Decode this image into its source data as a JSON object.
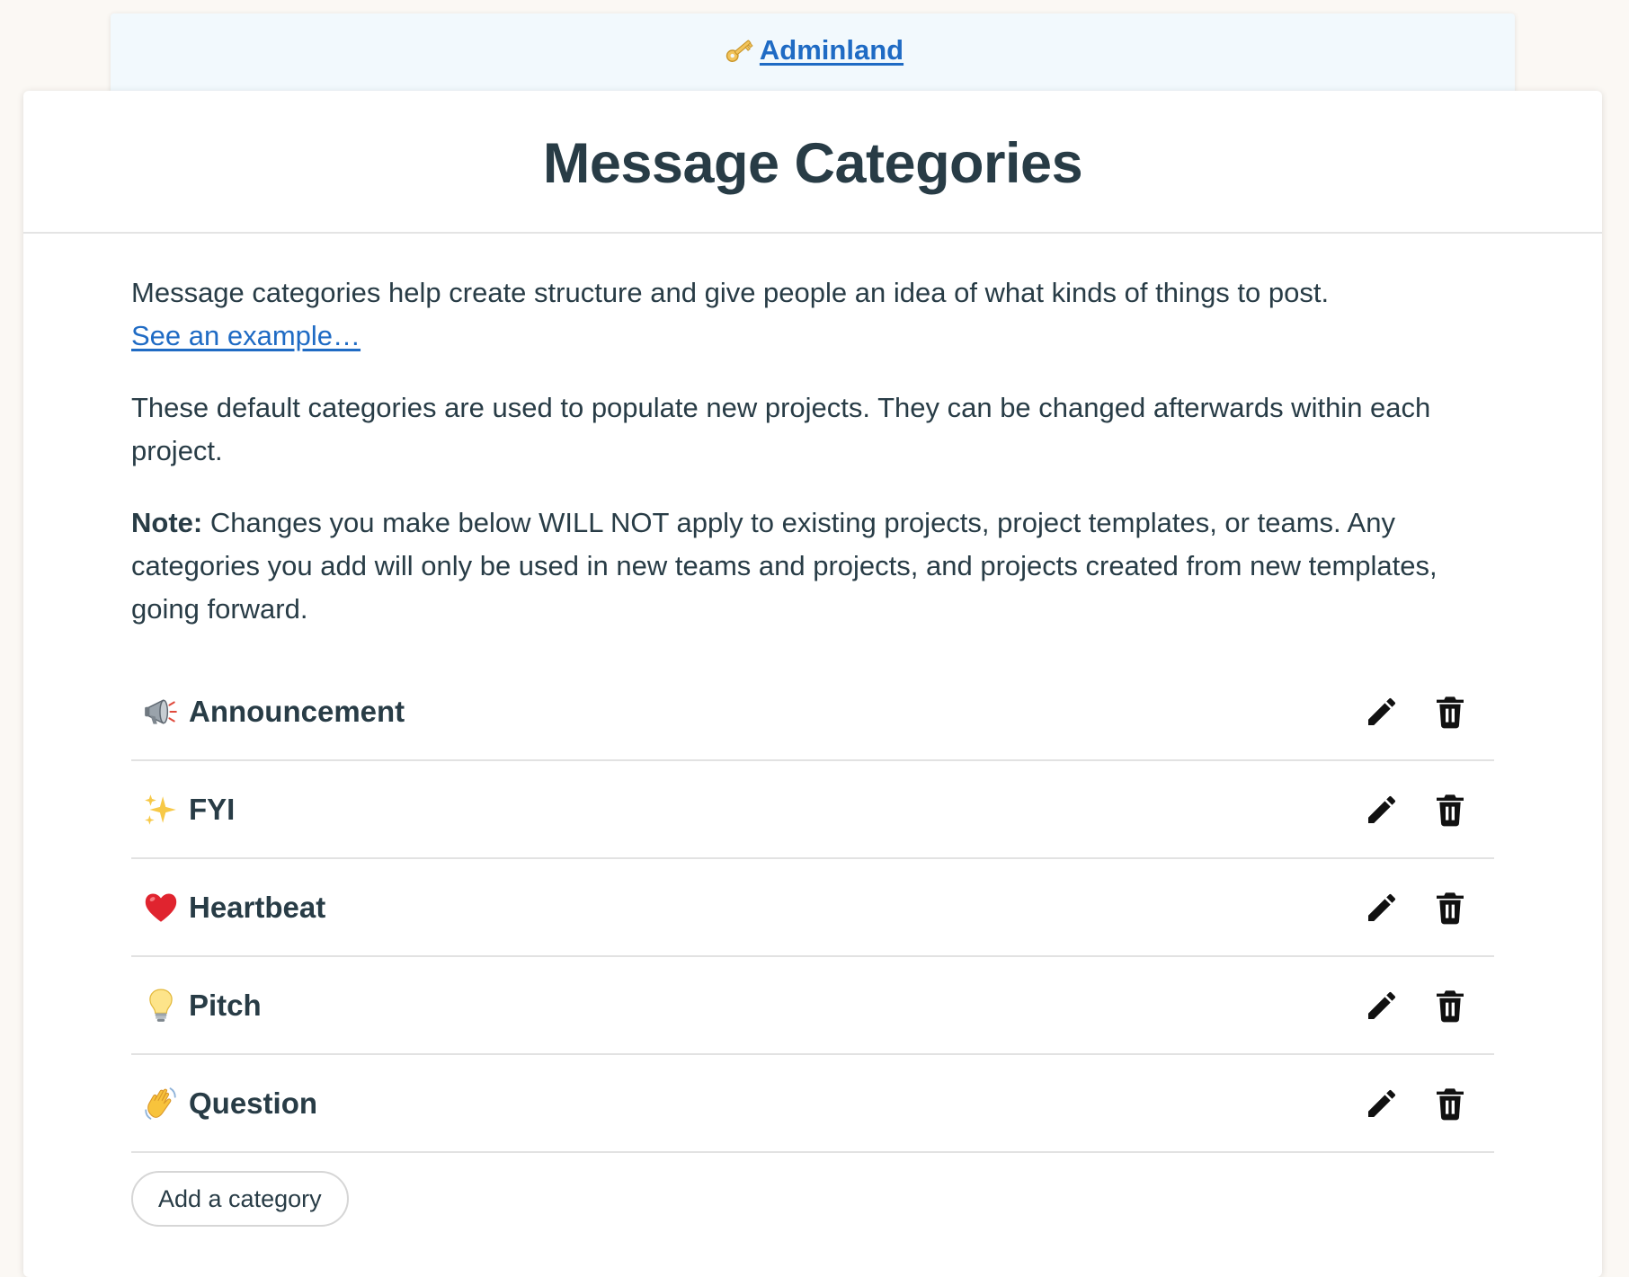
{
  "breadcrumb": {
    "icon": "key-icon",
    "label": "Adminland"
  },
  "page": {
    "title": "Message Categories"
  },
  "intro": {
    "text": "Message categories help create structure and give people an idea of what kinds of things to post.",
    "example_link": "See an example…"
  },
  "defaults_text": "These default categories are used to populate new projects. They can be changed afterwards within each project.",
  "note": {
    "label": "Note:",
    "text": " Changes you make below WILL NOT apply to existing projects, project templates, or teams. Any categories you add will only be used in new teams and projects, and projects created from new templates, going forward."
  },
  "categories": [
    {
      "icon": "megaphone-icon",
      "name": "Announcement"
    },
    {
      "icon": "sparkles-icon",
      "name": "FYI"
    },
    {
      "icon": "heart-icon",
      "name": "Heartbeat"
    },
    {
      "icon": "lightbulb-icon",
      "name": "Pitch"
    },
    {
      "icon": "waving-hand-icon",
      "name": "Question"
    }
  ],
  "row_actions": {
    "edit_icon": "pencil-icon",
    "delete_icon": "trash-icon"
  },
  "add_button": {
    "label": "Add a category"
  },
  "colors": {
    "link": "#1f6bc4",
    "text": "#283c46",
    "breadcrumb_bg": "#f2f9fd",
    "page_bg": "#fbf8f4"
  }
}
